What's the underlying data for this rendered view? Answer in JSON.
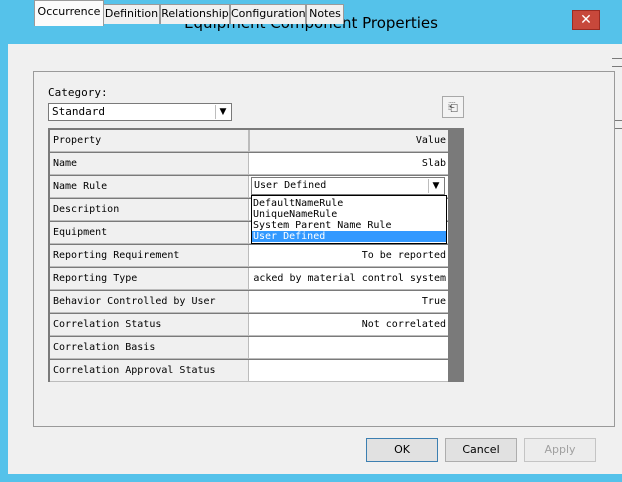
{
  "window": {
    "title": "Equipment Component Properties",
    "close_glyph": "✕"
  },
  "tabs": [
    {
      "label": "Occurrence",
      "active": true
    },
    {
      "label": "Definition",
      "active": false
    },
    {
      "label": "Relationship",
      "active": false
    },
    {
      "label": "Configuration",
      "active": false
    },
    {
      "label": "Notes",
      "active": false
    }
  ],
  "category": {
    "label": "Category:",
    "value": "Standard"
  },
  "grid": {
    "header": {
      "property": "Property",
      "value": "Value"
    },
    "rows": [
      {
        "property": "Name",
        "value": "Slab"
      },
      {
        "property": "Name Rule",
        "value": "User Defined"
      },
      {
        "property": "Description",
        "value": ""
      },
      {
        "property": "Equipment",
        "value": ""
      },
      {
        "property": "Reporting Requirement",
        "value": "To be reported"
      },
      {
        "property": "Reporting Type",
        "value": "acked by material control system"
      },
      {
        "property": "Behavior Controlled by User",
        "value": "True"
      },
      {
        "property": "Correlation Status",
        "value": "Not correlated"
      },
      {
        "property": "Correlation Basis",
        "value": ""
      },
      {
        "property": "Correlation Approval Status",
        "value": ""
      }
    ]
  },
  "name_rule_dropdown": {
    "selected": "User Defined",
    "options": [
      "DefaultNameRule",
      "UniqueNameRule",
      "System Parent Name Rule",
      "User Defined"
    ]
  },
  "buttons": {
    "ok": "OK",
    "cancel": "Cancel",
    "apply": "Apply"
  },
  "colors": {
    "titlebar": "#55c2ea",
    "close": "#c7483b",
    "selection": "#3399ff"
  }
}
